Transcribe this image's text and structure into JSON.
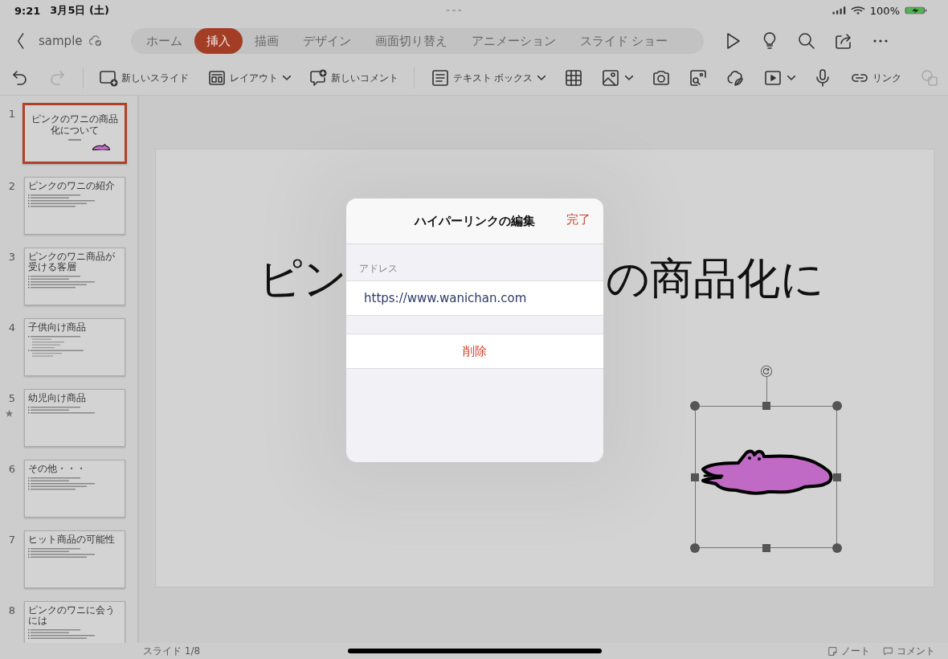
{
  "status_bar": {
    "time": "9:21",
    "date": "3月5日 (土)",
    "battery": "100%"
  },
  "header": {
    "file_name": "sample",
    "tabs": [
      {
        "label": "ホーム",
        "selected": false
      },
      {
        "label": "挿入",
        "selected": true
      },
      {
        "label": "描画",
        "selected": false
      },
      {
        "label": "デザイン",
        "selected": false
      },
      {
        "label": "画面切り替え",
        "selected": false
      },
      {
        "label": "アニメーション",
        "selected": false
      },
      {
        "label": "スライド ショー",
        "selected": false
      }
    ]
  },
  "toolbar": [
    {
      "kind": "undo",
      "disabled": false
    },
    {
      "kind": "redo",
      "disabled": true
    },
    {
      "kind": "new-slide",
      "label": "新しいスライド",
      "disabled": false
    },
    {
      "kind": "layout",
      "label": "レイアウト",
      "dropdown": true,
      "disabled": false
    },
    {
      "kind": "comment",
      "label": "新しいコメント",
      "disabled": false
    },
    {
      "kind": "textbox",
      "label": "テキスト ボックス",
      "dropdown": true,
      "disabled": false
    },
    {
      "kind": "table",
      "disabled": false
    },
    {
      "kind": "picture",
      "dropdown": true,
      "disabled": false
    },
    {
      "kind": "camera",
      "disabled": false
    },
    {
      "kind": "image-search",
      "disabled": false
    },
    {
      "kind": "plant",
      "disabled": false
    },
    {
      "kind": "video",
      "dropdown": true,
      "disabled": false
    },
    {
      "kind": "mic",
      "disabled": false
    },
    {
      "kind": "link",
      "label": "リンク",
      "disabled": false
    },
    {
      "kind": "shapes",
      "disabled": true
    }
  ],
  "slides": [
    {
      "number": "1",
      "kind": "title",
      "title": "ピンクのワニの商品化について",
      "selected": true,
      "animated": false
    },
    {
      "number": "2",
      "kind": "content",
      "title": "ピンクのワニの紹介",
      "selected": false,
      "animated": false,
      "text_lines": [
        {
          "kind": "bullet"
        },
        {
          "kind": "bullet"
        },
        {
          "kind": "bullet"
        },
        {
          "kind": "bullet"
        },
        {
          "kind": "bullet"
        }
      ]
    },
    {
      "number": "3",
      "kind": "content",
      "title": "ピンクのワニ商品が受ける客層",
      "selected": false,
      "animated": false,
      "text_lines": [
        {
          "kind": "bullet"
        },
        {
          "kind": "bullet"
        },
        {
          "kind": "bullet"
        },
        {
          "kind": "bullet"
        },
        {
          "kind": "bullet"
        }
      ]
    },
    {
      "number": "4",
      "kind": "content",
      "title": "子供向け商品",
      "selected": false,
      "animated": false,
      "text_lines": [
        {
          "kind": "bullet"
        },
        {
          "kind": "sub"
        },
        {
          "kind": "sub"
        },
        {
          "kind": "sub"
        },
        {
          "kind": "sub"
        },
        {
          "kind": "bullet"
        },
        {
          "kind": "sub"
        },
        {
          "kind": "sub"
        }
      ]
    },
    {
      "number": "5",
      "kind": "content",
      "title": "幼児向け商品",
      "selected": false,
      "animated": true,
      "text_lines": [
        {
          "kind": "bullet"
        },
        {
          "kind": "bullet"
        },
        {
          "kind": "bullet"
        }
      ]
    },
    {
      "number": "6",
      "kind": "content",
      "title": "その他・・・",
      "selected": false,
      "animated": false,
      "text_lines": [
        {
          "kind": "bullet"
        },
        {
          "kind": "bullet"
        },
        {
          "kind": "bullet"
        },
        {
          "kind": "bullet"
        },
        {
          "kind": "bullet"
        }
      ]
    },
    {
      "number": "7",
      "kind": "content",
      "title": "ヒット商品の可能性",
      "selected": false,
      "animated": false,
      "text_lines": [
        {
          "kind": "bullet"
        },
        {
          "kind": "bullet"
        },
        {
          "kind": "bullet"
        },
        {
          "kind": "bullet"
        }
      ]
    },
    {
      "number": "8",
      "kind": "content",
      "title": "ピンクのワニに会うには",
      "selected": false,
      "animated": false,
      "text_lines": [
        {
          "kind": "bullet"
        },
        {
          "kind": "bullet"
        },
        {
          "kind": "bullet"
        },
        {
          "kind": "bullet"
        }
      ]
    }
  ],
  "main_slide": {
    "title_fragments": [
      {
        "text": "ピン"
      },
      {
        "text": "の商品化に"
      }
    ],
    "picture_selected": true
  },
  "dialog": {
    "title": "ハイパーリンクの編集",
    "done": "完了",
    "address_label": "アドレス",
    "address": "https://www.wanichan.com",
    "delete": "削除"
  },
  "footer": {
    "slide_counter": "スライド 1/8",
    "notes": "ノート",
    "comments": "コメント"
  }
}
